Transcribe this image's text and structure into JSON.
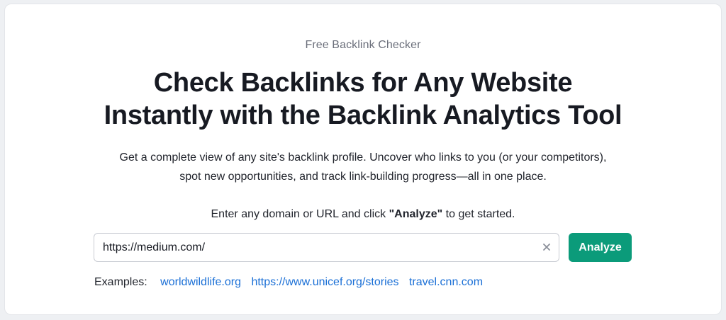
{
  "hero": {
    "eyebrow": "Free Backlink Checker",
    "headline_line1": "Check Backlinks for Any Website",
    "headline_line2": "Instantly with the Backlink Analytics Tool",
    "description_line1": "Get a complete view of any site's backlink profile. Uncover who links to you (or your competitors),",
    "description_line2": "spot new opportunities, and track link-building progress—all in one place."
  },
  "instruction": {
    "prefix": "Enter any domain or URL and click ",
    "emphasis": "\"Analyze\"",
    "suffix": " to get started."
  },
  "search": {
    "value": "https://medium.com/",
    "clear_icon": "close-icon",
    "button_label": "Analyze"
  },
  "examples": {
    "label": "Examples:",
    "links": [
      "worldwildlife.org",
      "https://www.unicef.org/stories",
      "travel.cnn.com"
    ]
  },
  "colors": {
    "accent": "#0b9b7a",
    "link": "#1a6fd6",
    "heading": "#171a22",
    "muted": "#6b6f7b"
  }
}
